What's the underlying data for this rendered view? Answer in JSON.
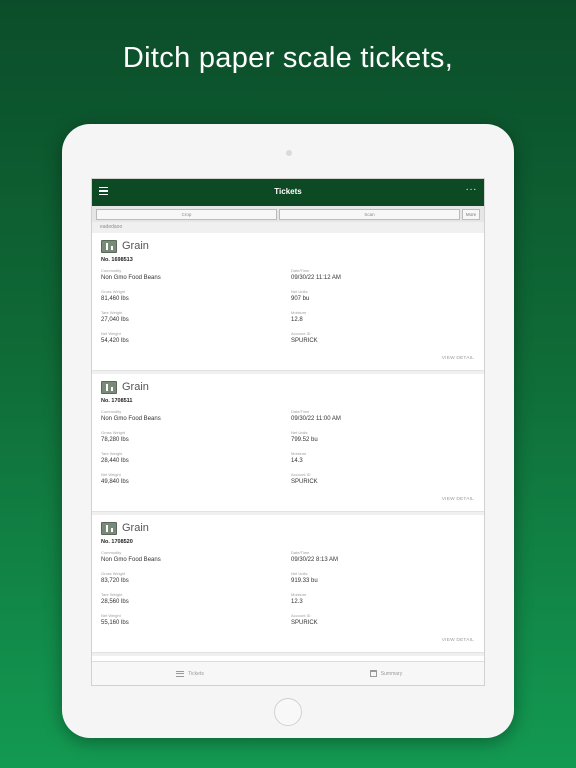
{
  "headline": "Ditch paper scale tickets,",
  "nav": {
    "title": "Tickets",
    "more": "···"
  },
  "search": {
    "left_placeholder": "Crop",
    "right_placeholder": "Scan",
    "more_label": "More"
  },
  "user": "eadedaoo",
  "field_labels": {
    "commodity": "Commodity",
    "gross": "Gross Weight",
    "tare": "Tare Weight",
    "net": "Net Weight",
    "date": "Date/Time",
    "units": "Net Units",
    "moisture": "Moisture",
    "account": "Account ID"
  },
  "view_detail": "VIEW DETAIL",
  "tickets": [
    {
      "type": "Grain",
      "number": "No. 1698513",
      "commodity": "Non Gmo Food Beans",
      "gross": "81,460 lbs",
      "tare": "27,040 lbs",
      "net": "54,420 lbs",
      "date": "09/30/22 11:12 AM",
      "units": "907 bu",
      "moisture": "12.8",
      "account": "SPURICK"
    },
    {
      "type": "Grain",
      "number": "No. 1708511",
      "commodity": "Non Gmo Food Beans",
      "gross": "78,280 lbs",
      "tare": "28,440 lbs",
      "net": "49,840 lbs",
      "date": "09/30/22 11:00 AM",
      "units": "799.52 bu",
      "moisture": "14.3",
      "account": "SPURICK"
    },
    {
      "type": "Grain",
      "number": "No. 1708520",
      "commodity": "Non Gmo Food Beans",
      "gross": "83,720 lbs",
      "tare": "28,560 lbs",
      "net": "55,160 lbs",
      "date": "09/30/22 8:13 AM",
      "units": "919.33 bu",
      "moisture": "12.3",
      "account": "SPURICK"
    }
  ],
  "partial": {
    "type": "Grain"
  },
  "tabs": [
    {
      "label": "Tickets",
      "icon": "list-icon"
    },
    {
      "label": "Summary",
      "icon": "calendar-icon"
    }
  ]
}
